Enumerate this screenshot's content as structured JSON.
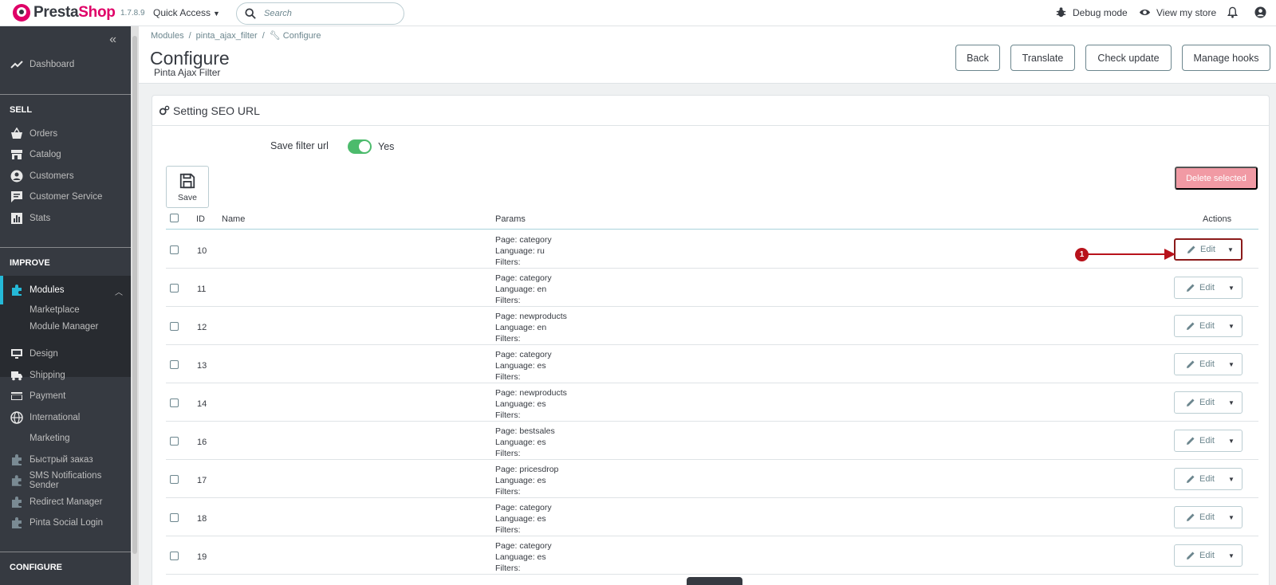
{
  "header": {
    "logo_presta": "Presta",
    "logo_shop": "Shop",
    "version": "1.7.8.9",
    "quick_access": "Quick Access",
    "search_placeholder": "Search",
    "debug_mode": "Debug mode",
    "view_store": "View my store"
  },
  "sidebar": {
    "dashboard": "Dashboard",
    "section_sell": "SELL",
    "orders": "Orders",
    "catalog": "Catalog",
    "customers": "Customers",
    "customer_service": "Customer Service",
    "stats": "Stats",
    "section_improve": "IMPROVE",
    "modules": "Modules",
    "marketplace": "Marketplace",
    "module_manager": "Module Manager",
    "design": "Design",
    "shipping": "Shipping",
    "payment": "Payment",
    "international": "International",
    "marketing": "Marketing",
    "quick_order": "Быстрый заказ",
    "sms": "SMS Notifications Sender",
    "redirect": "Redirect Manager",
    "social_login": "Pinta Social Login",
    "section_configure": "CONFIGURE"
  },
  "breadcrumb": {
    "modules": "Modules",
    "module": "pinta_ajax_filter",
    "current": "Configure"
  },
  "page": {
    "title": "Configure",
    "subtitle": "Pinta Ajax Filter",
    "back": "Back",
    "translate": "Translate",
    "check_update": "Check update",
    "manage_hooks": "Manage hooks"
  },
  "panel": {
    "title": "Setting SEO URL",
    "save_filter_label": "Save filter url",
    "save_filter_value": "Yes",
    "save": "Save",
    "delete_selected": "Delete selected"
  },
  "table": {
    "columns": {
      "id": "ID",
      "name": "Name",
      "params": "Params",
      "actions": "Actions"
    },
    "edit_label": "Edit",
    "rows": [
      {
        "id": "10",
        "page": "Page: category",
        "lang": "Language: ru",
        "filters": "Filters:"
      },
      {
        "id": "11",
        "page": "Page: category",
        "lang": "Language: en",
        "filters": "Filters:"
      },
      {
        "id": "12",
        "page": "Page: newproducts",
        "lang": "Language: en",
        "filters": "Filters:"
      },
      {
        "id": "13",
        "page": "Page: category",
        "lang": "Language: es",
        "filters": "Filters:"
      },
      {
        "id": "14",
        "page": "Page: newproducts",
        "lang": "Language: es",
        "filters": "Filters:"
      },
      {
        "id": "16",
        "page": "Page: bestsales",
        "lang": "Language: es",
        "filters": "Filters:"
      },
      {
        "id": "17",
        "page": "Page: pricesdrop",
        "lang": "Language: es",
        "filters": "Filters:"
      },
      {
        "id": "18",
        "page": "Page: category",
        "lang": "Language: es",
        "filters": "Filters:"
      },
      {
        "id": "19",
        "page": "Page: category",
        "lang": "Language: es",
        "filters": "Filters:"
      }
    ]
  },
  "annotation": {
    "badge": "1"
  }
}
